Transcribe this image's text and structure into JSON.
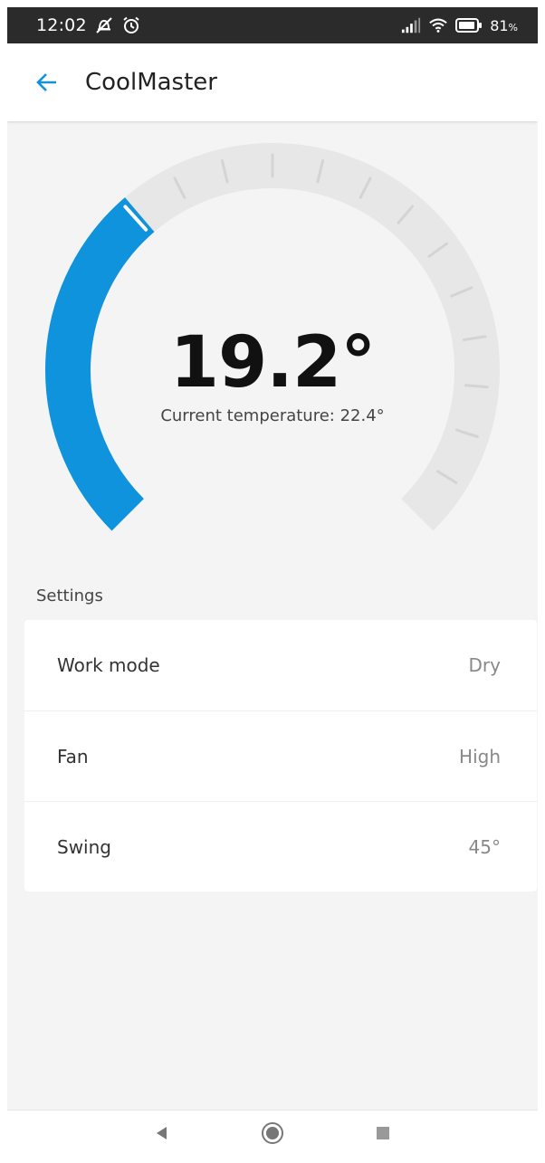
{
  "status_bar": {
    "time": "12:02",
    "battery_percent": "81",
    "battery_unit": "%",
    "icons": [
      "alarm-off-icon",
      "alarm-clock-icon",
      "signal-icon",
      "wifi-icon",
      "battery-icon"
    ]
  },
  "app_bar": {
    "title": "CoolMaster",
    "back_icon": "arrow-left-icon"
  },
  "thermostat": {
    "setpoint": "19.2°",
    "current_label": "Current temperature: 22.4°",
    "setpoint_fraction": 0.35,
    "colors": {
      "active": "#0f93dc",
      "track": "#e7e7e7",
      "tick": "#d4d4d4",
      "marker": "#ffffff"
    }
  },
  "settings": {
    "section_title": "Settings",
    "items": [
      {
        "name": "Work mode",
        "value": "Dry"
      },
      {
        "name": "Fan",
        "value": "High"
      },
      {
        "name": "Swing",
        "value": "45°"
      }
    ]
  },
  "nav_bar": {
    "icons": [
      "back-triangle-icon",
      "home-circle-icon",
      "recents-square-icon"
    ]
  },
  "colors": {
    "accent": "#0f93dc",
    "background": "#f4f4f4",
    "status_bar": "#2b2b2b"
  }
}
